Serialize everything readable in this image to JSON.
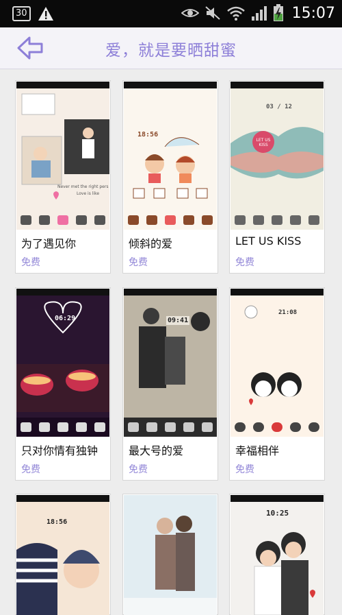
{
  "status_bar": {
    "notification_count": "30",
    "time": "15:07",
    "icons": [
      "warning-icon",
      "eye-icon",
      "mute-icon",
      "wifi-icon",
      "signal-icon",
      "battery-charging-icon"
    ]
  },
  "header": {
    "back_icon": "back-arrow-icon",
    "title": "爱，就是要晒甜蜜"
  },
  "themes": [
    {
      "name": "为了遇见你",
      "price": "免费",
      "clock": "",
      "preview_text": [
        "Never met the right pers",
        "Love is like"
      ]
    },
    {
      "name": "倾斜的爱",
      "price": "免费",
      "clock": "18:56"
    },
    {
      "name": "LET US KISS",
      "price": "免费",
      "clock": "03 / 12",
      "preview_text": [
        "LET US KISS"
      ]
    },
    {
      "name": "只对你情有独钟",
      "price": "免费",
      "clock": "06:29"
    },
    {
      "name": "最大号的爱",
      "price": "免费",
      "clock": "09:41"
    },
    {
      "name": "幸福相伴",
      "price": "免费",
      "clock": "21:08"
    },
    {
      "name": "",
      "price": "",
      "clock": "18:56"
    },
    {
      "name": "",
      "price": "",
      "clock": ""
    },
    {
      "name": "",
      "price": "",
      "clock": "10:25"
    }
  ],
  "colors": {
    "accent": "#8d7fd8",
    "price": "#9489d8",
    "status_bar": "#0a0a0a",
    "title_bar": "#f4f3f8"
  }
}
